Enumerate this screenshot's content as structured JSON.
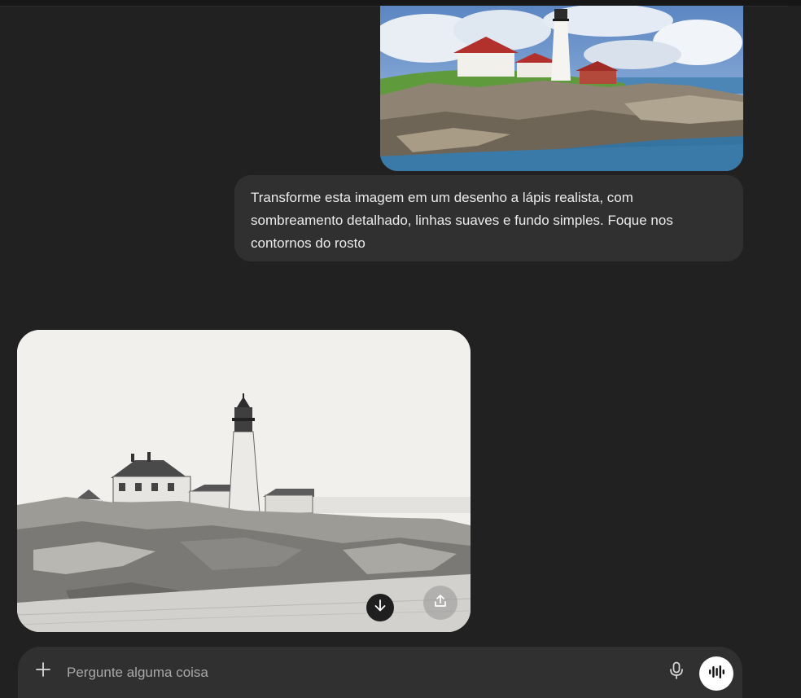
{
  "conversation": {
    "user_message": {
      "image_icon": "lighthouse-photo",
      "text": "Transforme esta imagem em um desenho a lápis realista, com sombreamento detalhado, linhas suaves e fundo simples. Foque nos contornos do rosto"
    },
    "assistant_message": {
      "image_icon": "lighthouse-pencil-sketch",
      "download_icon": "arrow-down-icon",
      "share_icon": "share-upload-icon"
    }
  },
  "composer": {
    "placeholder": "Pergunte alguma coisa",
    "value": "",
    "plus_icon": "plus-icon",
    "mic_icon": "microphone-icon",
    "voice_icon": "voice-waveform-icon"
  },
  "colors": {
    "background": "#212121",
    "bubble": "#303030",
    "text": "#ececec",
    "placeholder": "#a8a8a8"
  }
}
